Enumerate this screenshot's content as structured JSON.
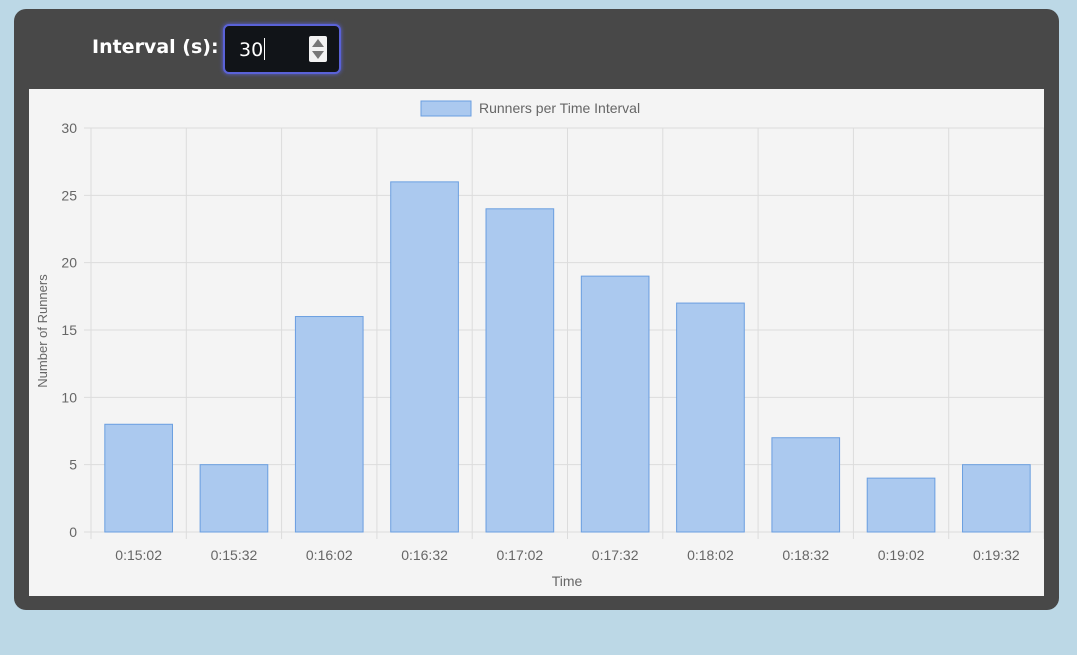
{
  "controls": {
    "interval_label": "Interval (s):",
    "interval_value": "30"
  },
  "colors": {
    "bar_fill": "#abc9ef",
    "bar_stroke": "#6a9ee0",
    "grid": "#dcdcdc",
    "text": "#666666",
    "panel": "#484848",
    "page_bg": "#bcd8e6",
    "input_border": "#5a62d8"
  },
  "chart_data": {
    "type": "bar",
    "title": "",
    "xlabel": "Time",
    "ylabel": "Number of Runners",
    "ylim": [
      0,
      30
    ],
    "yticks": [
      0,
      5,
      10,
      15,
      20,
      25,
      30
    ],
    "grid": true,
    "legend_position": "top-center",
    "categories": [
      "0:15:02",
      "0:15:32",
      "0:16:02",
      "0:16:32",
      "0:17:02",
      "0:17:32",
      "0:18:02",
      "0:18:32",
      "0:19:02",
      "0:19:32"
    ],
    "series": [
      {
        "name": "Runners per Time Interval",
        "values": [
          8,
          5,
          16,
          26,
          24,
          19,
          17,
          7,
          4,
          5
        ]
      }
    ]
  }
}
